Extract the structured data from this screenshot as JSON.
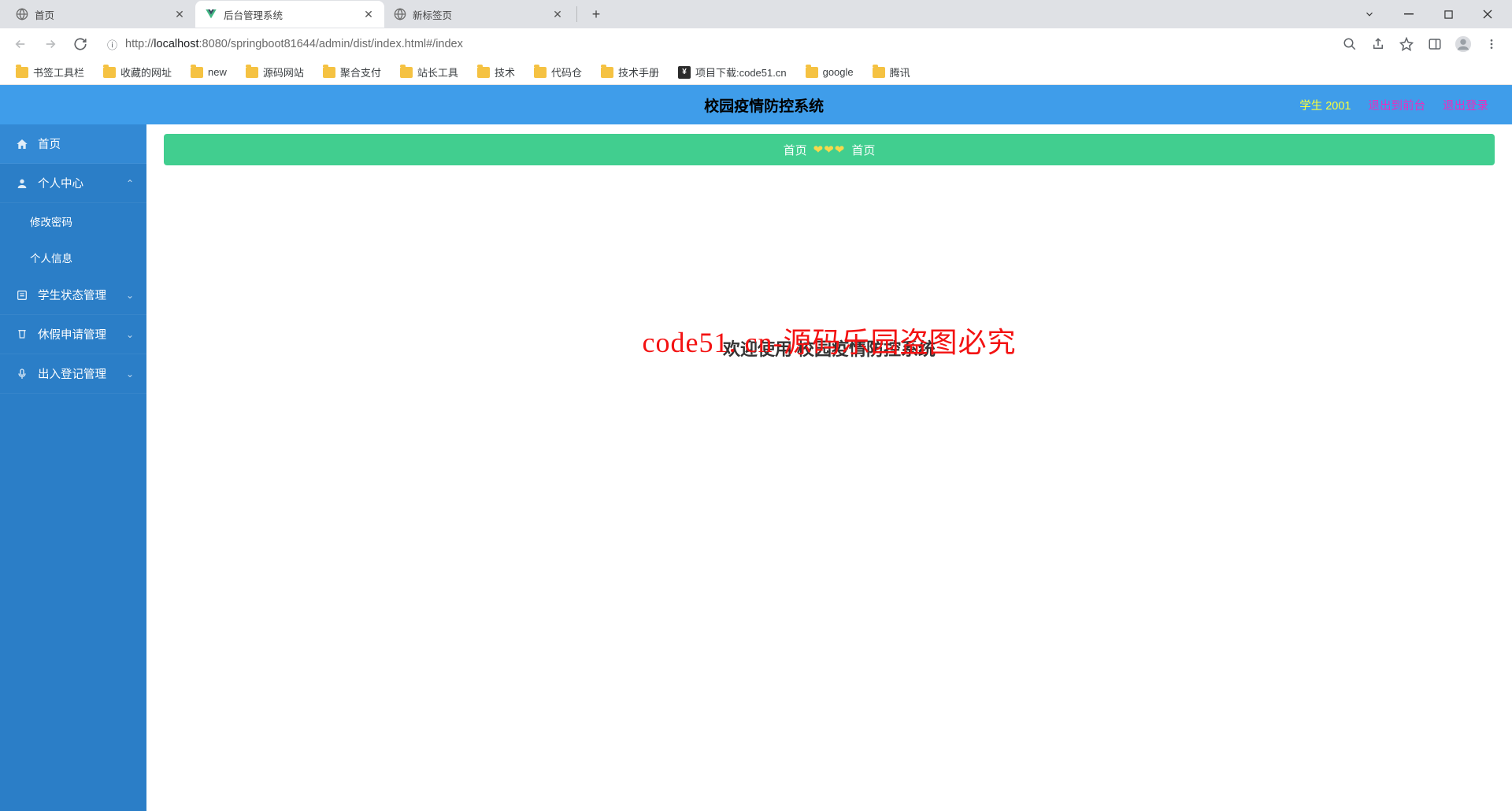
{
  "browser": {
    "tabs": [
      {
        "title": "首页",
        "active": false,
        "favicon": "globe"
      },
      {
        "title": "后台管理系统",
        "active": true,
        "favicon": "vue"
      },
      {
        "title": "新标签页",
        "active": false,
        "favicon": "globe"
      }
    ],
    "url_host": "localhost",
    "url_port": ":8080",
    "url_path": "/springboot81644/admin/dist/index.html#/index",
    "url_scheme_prefix": "http://"
  },
  "bookmarks": [
    {
      "label": "书签工具栏",
      "icon": "folder"
    },
    {
      "label": "收藏的网址",
      "icon": "folder"
    },
    {
      "label": "new",
      "icon": "folder"
    },
    {
      "label": "源码网站",
      "icon": "folder"
    },
    {
      "label": "聚合支付",
      "icon": "folder"
    },
    {
      "label": "站长工具",
      "icon": "folder"
    },
    {
      "label": "技术",
      "icon": "folder"
    },
    {
      "label": "代码仓",
      "icon": "folder"
    },
    {
      "label": "技术手册",
      "icon": "folder"
    },
    {
      "label": "项目下载:code51.cn",
      "icon": "code51"
    },
    {
      "label": "google",
      "icon": "folder"
    },
    {
      "label": "腾讯",
      "icon": "folder"
    }
  ],
  "header": {
    "title": "校园疫情防控系统",
    "user_role": "学生",
    "user_id": "2001",
    "link_front": "退出到前台",
    "link_logout": "退出登录"
  },
  "sidebar": {
    "home": "首页",
    "personal": "个人中心",
    "personal_sub": {
      "change_pwd": "修改密码",
      "profile": "个人信息"
    },
    "student_status": "学生状态管理",
    "leave_apply": "休假申请管理",
    "access_log": "出入登记管理"
  },
  "breadcrumb": {
    "left": "首页",
    "right": "首页",
    "hearts": "❤❤❤"
  },
  "main": {
    "welcome": "欢迎使用 校园疫情防控系统",
    "watermark": "code51. cn-源码乐园盗图必究"
  }
}
